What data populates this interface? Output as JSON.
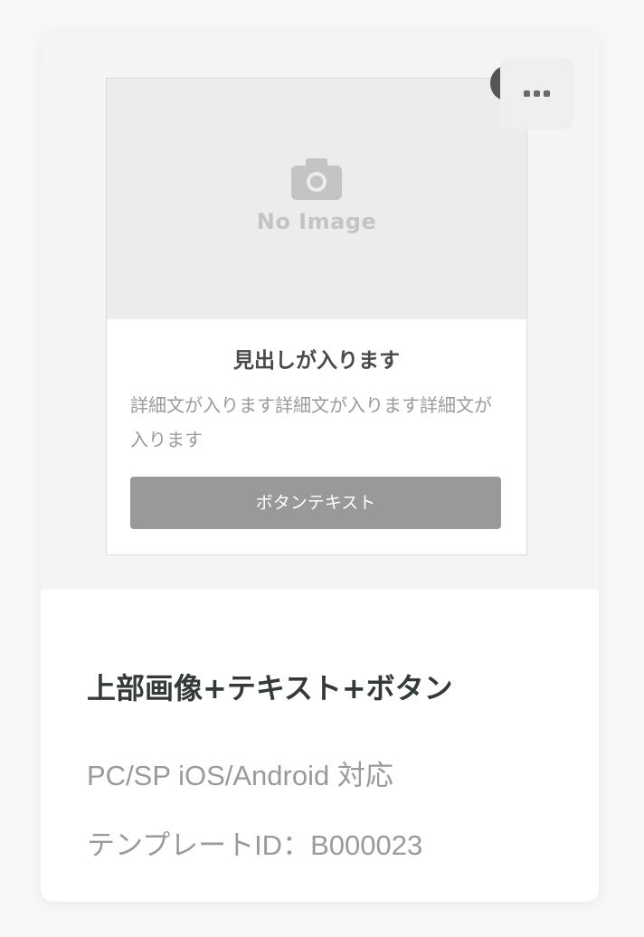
{
  "preview": {
    "no_image_label": "No Image",
    "heading": "見出しが入ります",
    "description": "詳細文が入ります詳細文が入ります詳細文が入ります",
    "button_label": "ボタンテキスト",
    "image_icon": "camera-icon"
  },
  "menu": {
    "icon": "more-horizontal-icon"
  },
  "template": {
    "title": "上部画像+テキスト+ボタン",
    "support": "PC/SP iOS/Android 対応",
    "id_label": "テンプレートID：B000023"
  },
  "colors": {
    "card_bg": "#ffffff",
    "preview_bg": "#f4f5f3",
    "button_bg": "#999999",
    "title_text": "#333a37",
    "muted_text": "#9a9a9a"
  }
}
